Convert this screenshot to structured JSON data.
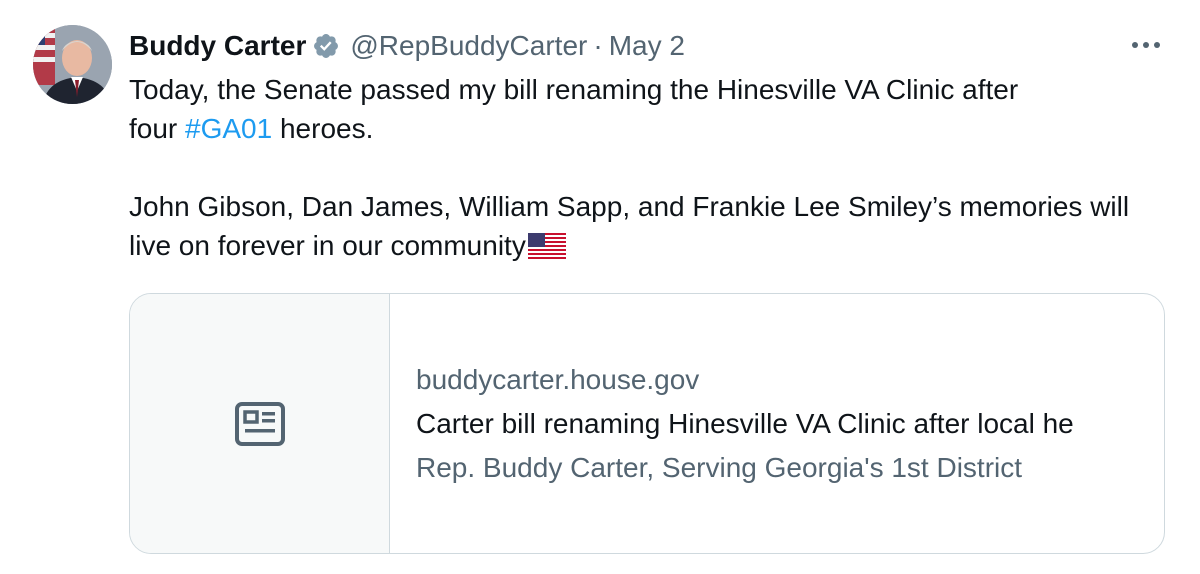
{
  "tweet": {
    "author_name": "Buddy Carter",
    "handle": "@RepBuddyCarter",
    "separator": "·",
    "date": "May 2",
    "text_line1_a": "Today, the Senate passed my bill renaming the Hinesville VA Clinic after",
    "text_line2_a": "four ",
    "hashtag": "#GA01",
    "text_line2_b": " heroes.",
    "text_para2": "John Gibson, Dan James, William Sapp, and Frankie Lee Smiley’s memories will live on forever in our community",
    "emoji": "us-flag"
  },
  "card": {
    "domain": "buddycarter.house.gov",
    "title": "Carter bill renaming Hinesville VA Clinic after local he",
    "description": "Rep. Buddy Carter, Serving Georgia's 1st District",
    "thumbnail_icon": "article-icon"
  },
  "colors": {
    "text": "#0f1419",
    "secondary": "#536471",
    "link": "#1d9bf0",
    "verified": "#829aab",
    "border": "#cfd9de",
    "thumb_bg": "#f7f9f9"
  },
  "icons": {
    "verified": "verified-badge-icon",
    "more": "more-options-icon"
  }
}
